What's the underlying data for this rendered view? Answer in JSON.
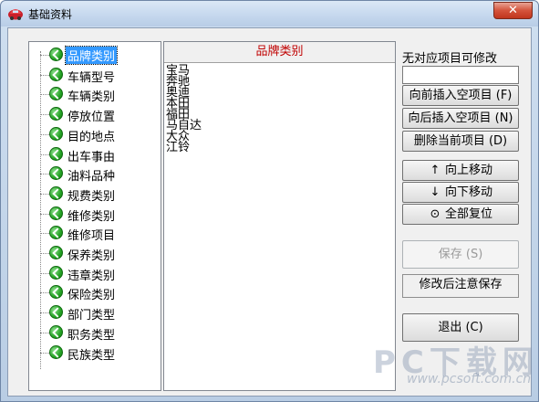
{
  "window": {
    "title": "基础资料",
    "close_label": "✕"
  },
  "tree": {
    "items": [
      {
        "label": "品牌类别",
        "selected": true
      },
      {
        "label": "车辆型号"
      },
      {
        "label": "车辆类别"
      },
      {
        "label": "停放位置"
      },
      {
        "label": "目的地点"
      },
      {
        "label": "出车事由"
      },
      {
        "label": "油料品种"
      },
      {
        "label": "规费类别"
      },
      {
        "label": "维修类别"
      },
      {
        "label": "维修项目"
      },
      {
        "label": "保养类别"
      },
      {
        "label": "违章类别"
      },
      {
        "label": "保险类别"
      },
      {
        "label": "部门类型"
      },
      {
        "label": "职务类型"
      },
      {
        "label": "民族类型"
      }
    ]
  },
  "list": {
    "header": "品牌类别",
    "rows": [
      "宝马",
      "奔驰",
      "奥迪",
      "本田",
      "福田",
      "马自达",
      "大众",
      "江铃"
    ]
  },
  "right": {
    "hint": "无对应项目可修改",
    "input_value": "",
    "insert_before_label": "向前插入空项目 (F)",
    "insert_after_label": "向后插入空项目 (N)",
    "delete_label": "删除当前项目 (D)",
    "move_up_label": "向上移动",
    "move_down_label": "向下移动",
    "reset_label": "全部复位",
    "save_label": "保存 (S)",
    "status": "修改后注意保存",
    "exit_label": "退出 (C)",
    "icons": {
      "up": "↑",
      "down": "↓",
      "reset": "⊙"
    }
  },
  "watermark": {
    "main": "PC下载网",
    "url": "www.pcsoft.com.cn"
  }
}
